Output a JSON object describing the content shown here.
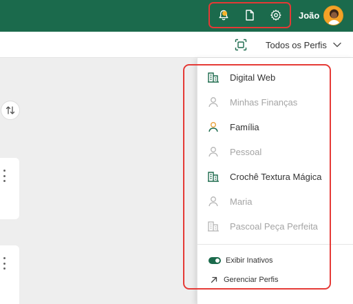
{
  "header": {
    "user_name": "João",
    "icons": [
      "bell-icon",
      "document-icon",
      "gear-icon"
    ]
  },
  "subbar": {
    "profile_select_label": "Todos os Perfis"
  },
  "profiles_menu": {
    "items": [
      {
        "label": "Digital Web",
        "icon": "building-icon",
        "active": true
      },
      {
        "label": "Minhas Finanças",
        "icon": "person-icon",
        "active": false
      },
      {
        "label": "Família",
        "icon": "person-icon",
        "active": true
      },
      {
        "label": "Pessoal",
        "icon": "person-icon",
        "active": false
      },
      {
        "label": "Crochê Textura Mágica",
        "icon": "building-icon",
        "active": true
      },
      {
        "label": "Maria",
        "icon": "person-icon",
        "active": false
      },
      {
        "label": "Pascoal Peça Perfeita",
        "icon": "building-icon",
        "active": false
      }
    ],
    "show_inactive_label": "Exibir Inativos",
    "show_inactive_on": true,
    "manage_label": "Gerenciar Perfis"
  },
  "colors": {
    "brand_green": "#1b6a4c",
    "notification_dot": "#f7b32b",
    "icon_active_green": "#1b6a4c",
    "icon_family_orange": "#e9a23b",
    "inactive_gray": "#a4a4a4",
    "highlight_red": "#e53935"
  }
}
